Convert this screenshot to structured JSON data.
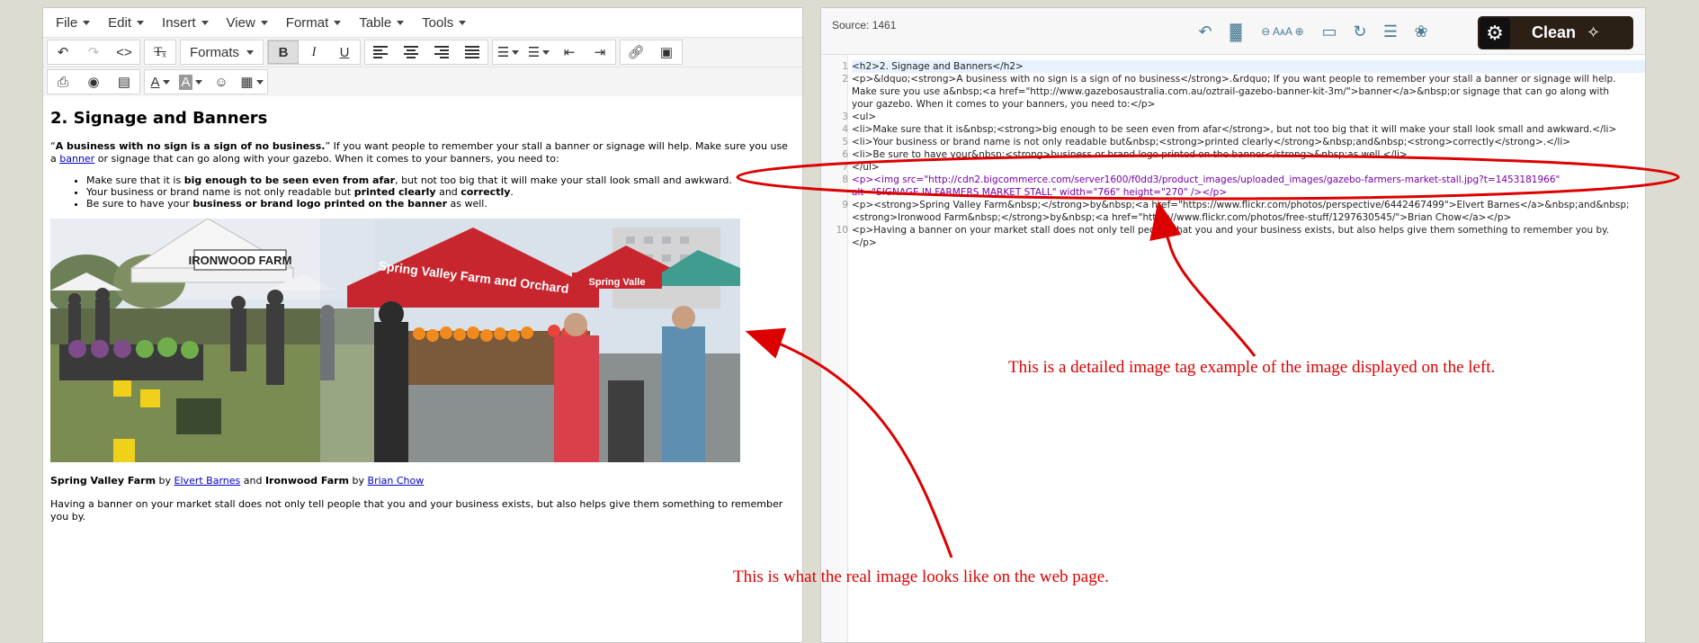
{
  "editor": {
    "menu": [
      {
        "label": "File"
      },
      {
        "label": "Edit"
      },
      {
        "label": "Insert"
      },
      {
        "label": "View"
      },
      {
        "label": "Format"
      },
      {
        "label": "Table"
      },
      {
        "label": "Tools"
      }
    ],
    "toolbar": {
      "formats_label": "Formats"
    },
    "content": {
      "heading": "2. Signage and Banners",
      "intro_quote_open": "“",
      "intro_bold": "A business with no sign is a sign of no business.",
      "intro_quote_close": "”",
      "intro_rest": " If you want people to remember your stall a banner or signage will help. Make sure you use a ",
      "intro_link": "banner",
      "intro_tail": " or signage that can go along with your gazebo. When it comes to your banners, you need to:",
      "li1_a": "Make sure that it is ",
      "li1_bold": "big enough to be seen even from afar",
      "li1_b": ", but not too big that it will make your stall look small and awkward.",
      "li2_a": "Your business or brand name is not only readable but ",
      "li2_bold1": "printed clearly",
      "li2_and": " and ",
      "li2_bold2": "correctly",
      "li2_end": ".",
      "li3_a": "Be sure to have your ",
      "li3_bold": "business or brand logo printed on the banner",
      "li3_b": " as well.",
      "image_left_sign": "IRONWOOD FARM",
      "image_right_sign": "Spring Valley Farm and Orchard",
      "image_right_sign2": "Spring Valle",
      "credit_bold1": "Spring Valley Farm",
      "credit_by1": " by ",
      "credit_link1": "Elvert Barnes",
      "credit_and": " and ",
      "credit_bold2": "Ironwood Farm",
      "credit_by2": " by ",
      "credit_link2": "Brian Chow",
      "closing": "Having a banner on your market stall does not only tell people that you and your business exists, but also helps give them something to remember you by."
    }
  },
  "source": {
    "count_label": "Source: 1461",
    "clean_label": "Clean",
    "icons": [
      "undo-icon",
      "file-icon",
      "font-decrease-icon",
      "font-increase-icon",
      "wrap-icon",
      "refresh-icon",
      "document-icon",
      "palette-icon"
    ],
    "line_numbers": [
      "1",
      "2",
      "3",
      "4",
      "5",
      "6",
      "7",
      "8",
      "9",
      "10"
    ],
    "lines": [
      "<h2>2. Signage and Banners</h2>",
      "<p>&ldquo;<strong>A business with no sign is a sign of no business</strong>.&rdquo; If you want people to remember your stall a banner or signage will help.",
      "Make sure you use a&nbsp;<a href=\"http://www.gazebosaustralia.com.au/oztrail-gazebo-banner-kit-3m/\">banner</a>&nbsp;or signage that can go along with",
      "your gazebo. When it comes to your banners, you need to:</p>",
      "<ul>",
      "<li>Make sure that it is&nbsp;<strong>big enough to be seen even from afar</strong>, but not too big that it will make your stall look small and awkward.</li>",
      "<li>Your business or brand name is not only readable but&nbsp;<strong>printed clearly</strong>&nbsp;and&nbsp;<strong>correctly</strong>.</li>",
      "<li>Be sure to have your&nbsp;<strong>business or brand logo printed on the banner</strong>&nbsp;as well.</li>",
      "</ul>",
      "<p><img src=\"http://cdn2.bigcommerce.com/server1600/f0dd3/product_images/uploaded_images/gazebo-farmers-market-stall.jpg?t=1453181966\"",
      "alt=\"SIGNAGE IN FARMERS MARKET STALL\" width=\"766\" height=\"270\" /></p>",
      "<p><strong>Spring Valley Farm&nbsp;</strong>by&nbsp;<a href=\"https://www.flickr.com/photos/perspective/6442467499\">Elvert Barnes</a>&nbsp;and&nbsp;",
      "<strong>Ironwood Farm&nbsp;</strong>by&nbsp;<a href=\"https://www.flickr.com/photos/free-stuff/1297630545/\">Brian Chow</a></p>",
      "<p>Having a banner on your market stall does not only tell people that you and your business exists, but also helps give them something to remember you by.",
      "</p>"
    ]
  },
  "annotations": {
    "right_note": "This is a detailed image tag example of the image displayed on the left.",
    "bottom_note": "This is what the real image looks like on the web page."
  },
  "colors": {
    "annotation": "#dd0000",
    "clean_button": "#2a2015",
    "link": "#0000cc"
  }
}
